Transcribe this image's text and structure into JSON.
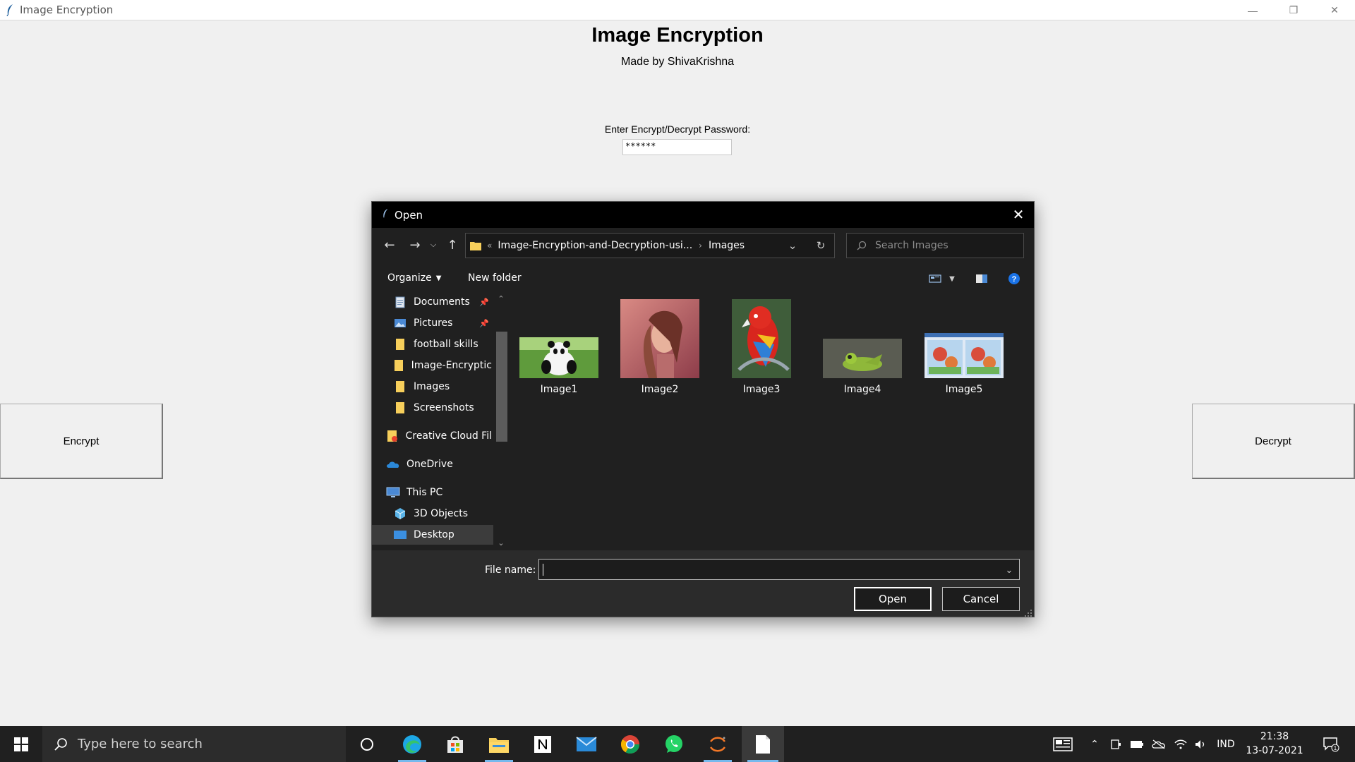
{
  "app": {
    "window_title": "Image Encryption",
    "heading": "Image Encryption",
    "subtitle": "Made by ShivaKrishna",
    "password_label": "Enter Encrypt/Decrypt Password:",
    "password_value": "******",
    "encrypt_label": "Encrypt",
    "decrypt_label": "Decrypt"
  },
  "dialog": {
    "title": "Open",
    "address": {
      "overflow": "«",
      "parent": "Image-Encryption-and-Decryption-usi...",
      "separator": "›",
      "current": "Images"
    },
    "search_placeholder": "Search Images",
    "toolbar": {
      "organize_label": "Organize",
      "new_folder_label": "New folder"
    },
    "sidebar": [
      {
        "label": "Documents",
        "icon": "documents-icon",
        "pinned": true
      },
      {
        "label": "Pictures",
        "icon": "pictures-icon",
        "pinned": true
      },
      {
        "label": "football skills",
        "icon": "folder-icon",
        "pinned": false
      },
      {
        "label": "Image-Encryptic",
        "icon": "folder-icon",
        "pinned": false
      },
      {
        "label": "Images",
        "icon": "folder-icon",
        "pinned": false
      },
      {
        "label": "Screenshots",
        "icon": "folder-icon",
        "pinned": false
      },
      {
        "label": "Creative Cloud Fil",
        "icon": "creative-cloud-icon",
        "pinned": false
      },
      {
        "label": "OneDrive",
        "icon": "onedrive-icon",
        "pinned": false
      },
      {
        "label": "This PC",
        "icon": "this-pc-icon",
        "pinned": false
      },
      {
        "label": "3D Objects",
        "icon": "3d-objects-icon",
        "pinned": false
      },
      {
        "label": "Desktop",
        "icon": "desktop-icon",
        "pinned": false,
        "selected": true
      }
    ],
    "files": [
      {
        "label": "Image1"
      },
      {
        "label": "Image2"
      },
      {
        "label": "Image3"
      },
      {
        "label": "Image4"
      },
      {
        "label": "Image5"
      }
    ],
    "file_name_label": "File name:",
    "file_name_value": "",
    "open_label": "Open",
    "cancel_label": "Cancel"
  },
  "taskbar": {
    "search_placeholder": "Type here to search",
    "language": "IND",
    "time": "21:38",
    "date": "13-07-2021",
    "notification_count": "1"
  },
  "colors": {
    "dialog_bg": "#202020",
    "taskbar_bg": "#202020",
    "app_bg": "#f0f0f0",
    "accent": "#76b9ed",
    "help": "#1a73e8"
  }
}
